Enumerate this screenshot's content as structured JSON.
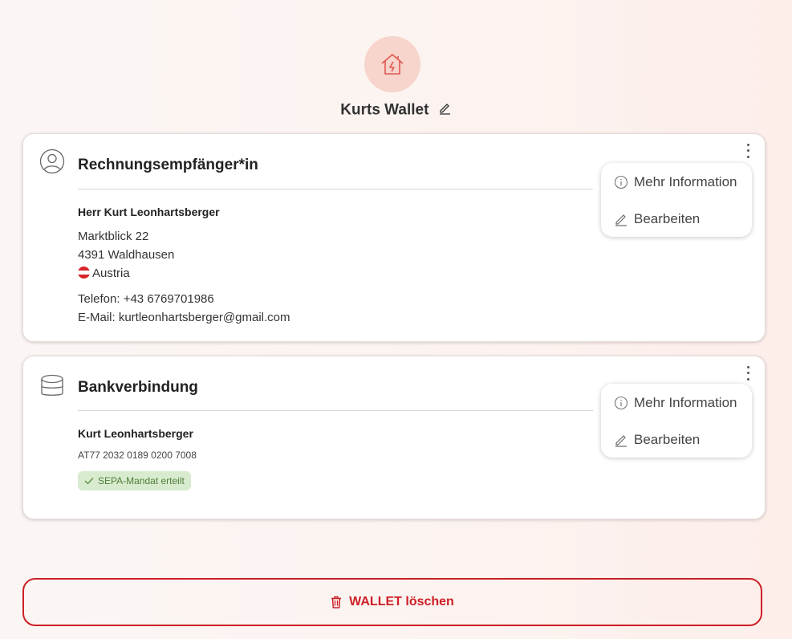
{
  "header": {
    "icon": "house-lightning-icon",
    "wallet_title": "Kurts Wallet",
    "accent_color": "#e8645a"
  },
  "recipient_card": {
    "title": "Rechnungsempfänger*in",
    "name": "Herr Kurt Leonhartsberger",
    "street": "Marktblick 22",
    "city": "4391 Waldhausen",
    "country": "Austria",
    "phone": "Telefon: +43 6769701986",
    "email": "E-Mail: kurtleonhartsberger@gmail.com",
    "menu": {
      "info": "Mehr Information",
      "edit": "Bearbeiten"
    }
  },
  "bank_card": {
    "title": "Bankverbindung",
    "name": "Kurt Leonhartsberger",
    "iban": "AT77 2032 0189 0200 7008",
    "badge": "SEPA-Mandat erteilt",
    "menu": {
      "info": "Mehr Information",
      "edit": "Bearbeiten"
    }
  },
  "delete_button": {
    "label": "WALLET löschen",
    "color": "#cc1f26"
  }
}
